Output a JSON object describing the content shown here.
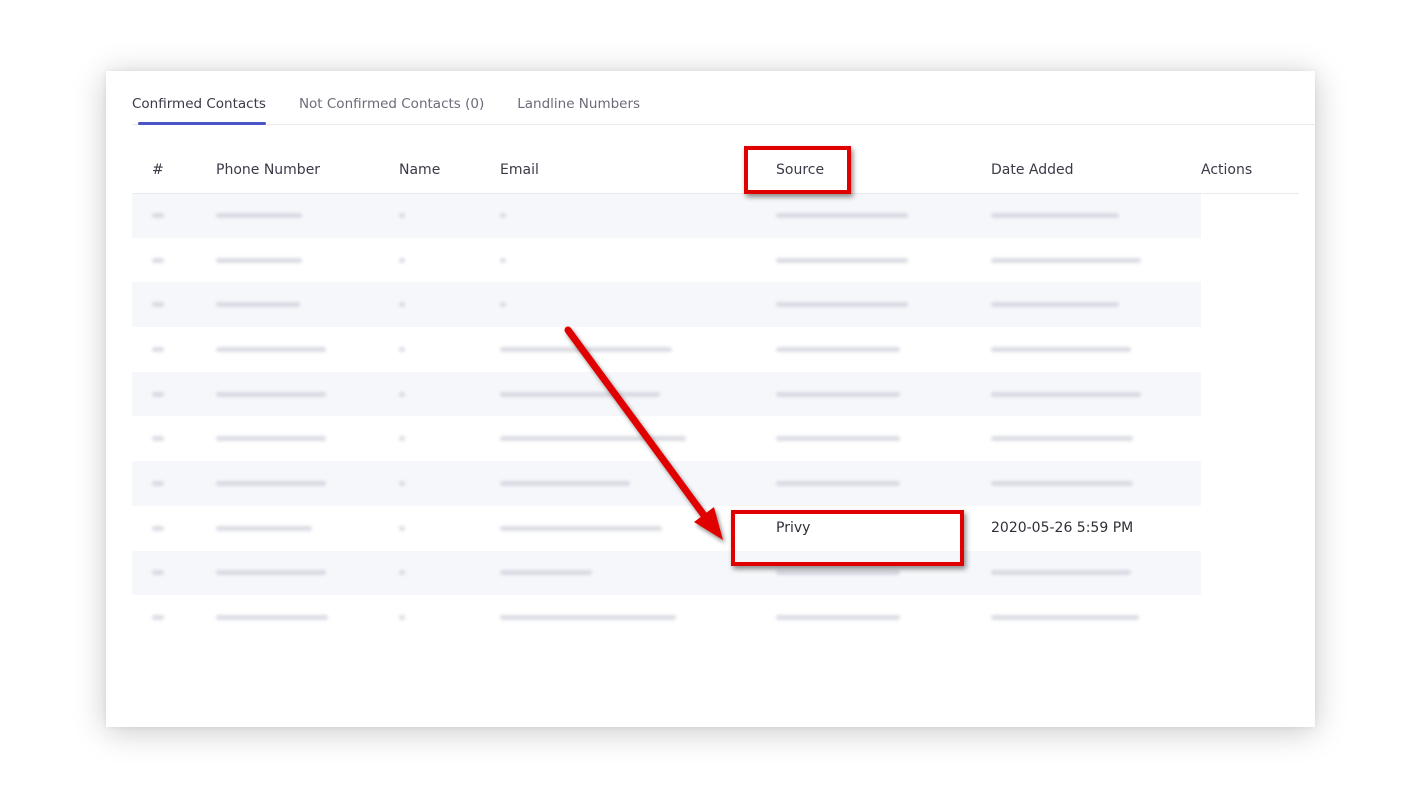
{
  "tabs": [
    {
      "label": "Confirmed Contacts",
      "active": true
    },
    {
      "label": "Not Confirmed Contacts (0)",
      "active": false
    },
    {
      "label": "Landline Numbers",
      "active": false
    }
  ],
  "table": {
    "headers": {
      "num": "#",
      "phone": "Phone Number",
      "name": "Name",
      "email": "Email",
      "source": "Source",
      "date": "Date Added",
      "actions": "Actions"
    },
    "highlighted_row": {
      "source": "Privy",
      "date_added": "2020-05-26 5:59 PM"
    }
  },
  "colors": {
    "accent": "#4a56c8",
    "annotation_red": "#e00000",
    "row_shade": "#f6f7fa"
  }
}
